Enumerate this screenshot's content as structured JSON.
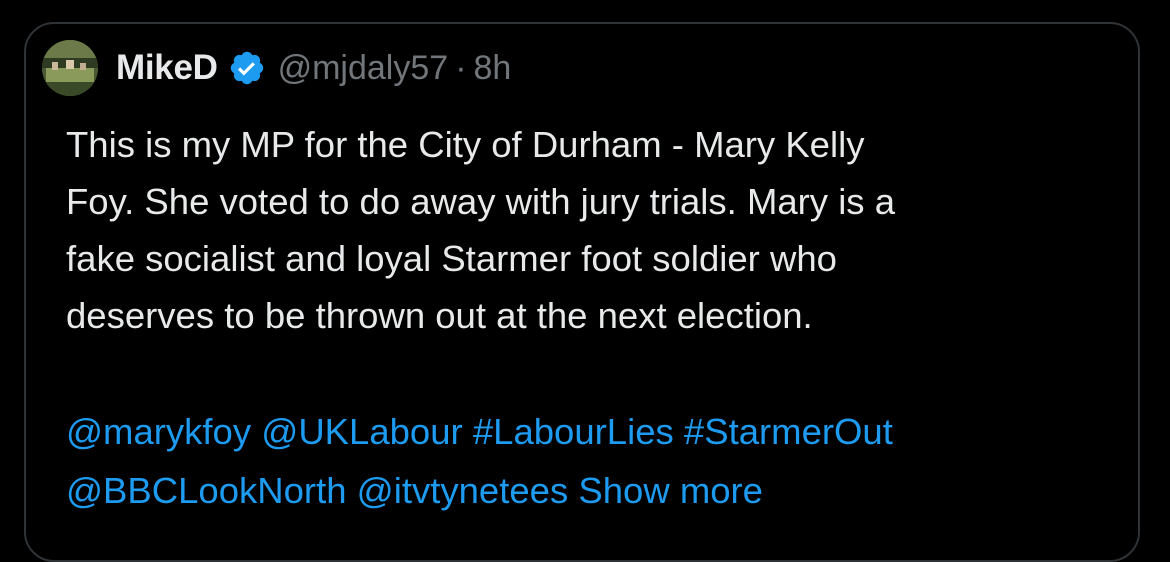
{
  "post": {
    "author_name": "MikeD",
    "handle": "@mjdaly57",
    "separator": "·",
    "time": "8h",
    "text_lines": [
      "This is my MP for the City of Durham - Mary Kelly",
      "Foy. She voted to do away with jury trials. Mary is a",
      "fake socialist and loyal Starmer foot soldier who",
      "deserves to be thrown out at the next election."
    ],
    "links_line1": [
      "@marykfoy",
      "@UKLabour",
      "#LabourLies",
      "#StarmerOut"
    ],
    "links_line2": [
      "@BBCLookNorth",
      "@itvtynetees"
    ],
    "show_more": "Show more"
  },
  "icons": {
    "avatar": "avatar-image",
    "verified": "verified-badge-icon"
  },
  "colors": {
    "background": "#000000",
    "text": "#e7e9ea",
    "secondary": "#71767b",
    "link": "#1d9bf0",
    "border": "#2f3336"
  }
}
